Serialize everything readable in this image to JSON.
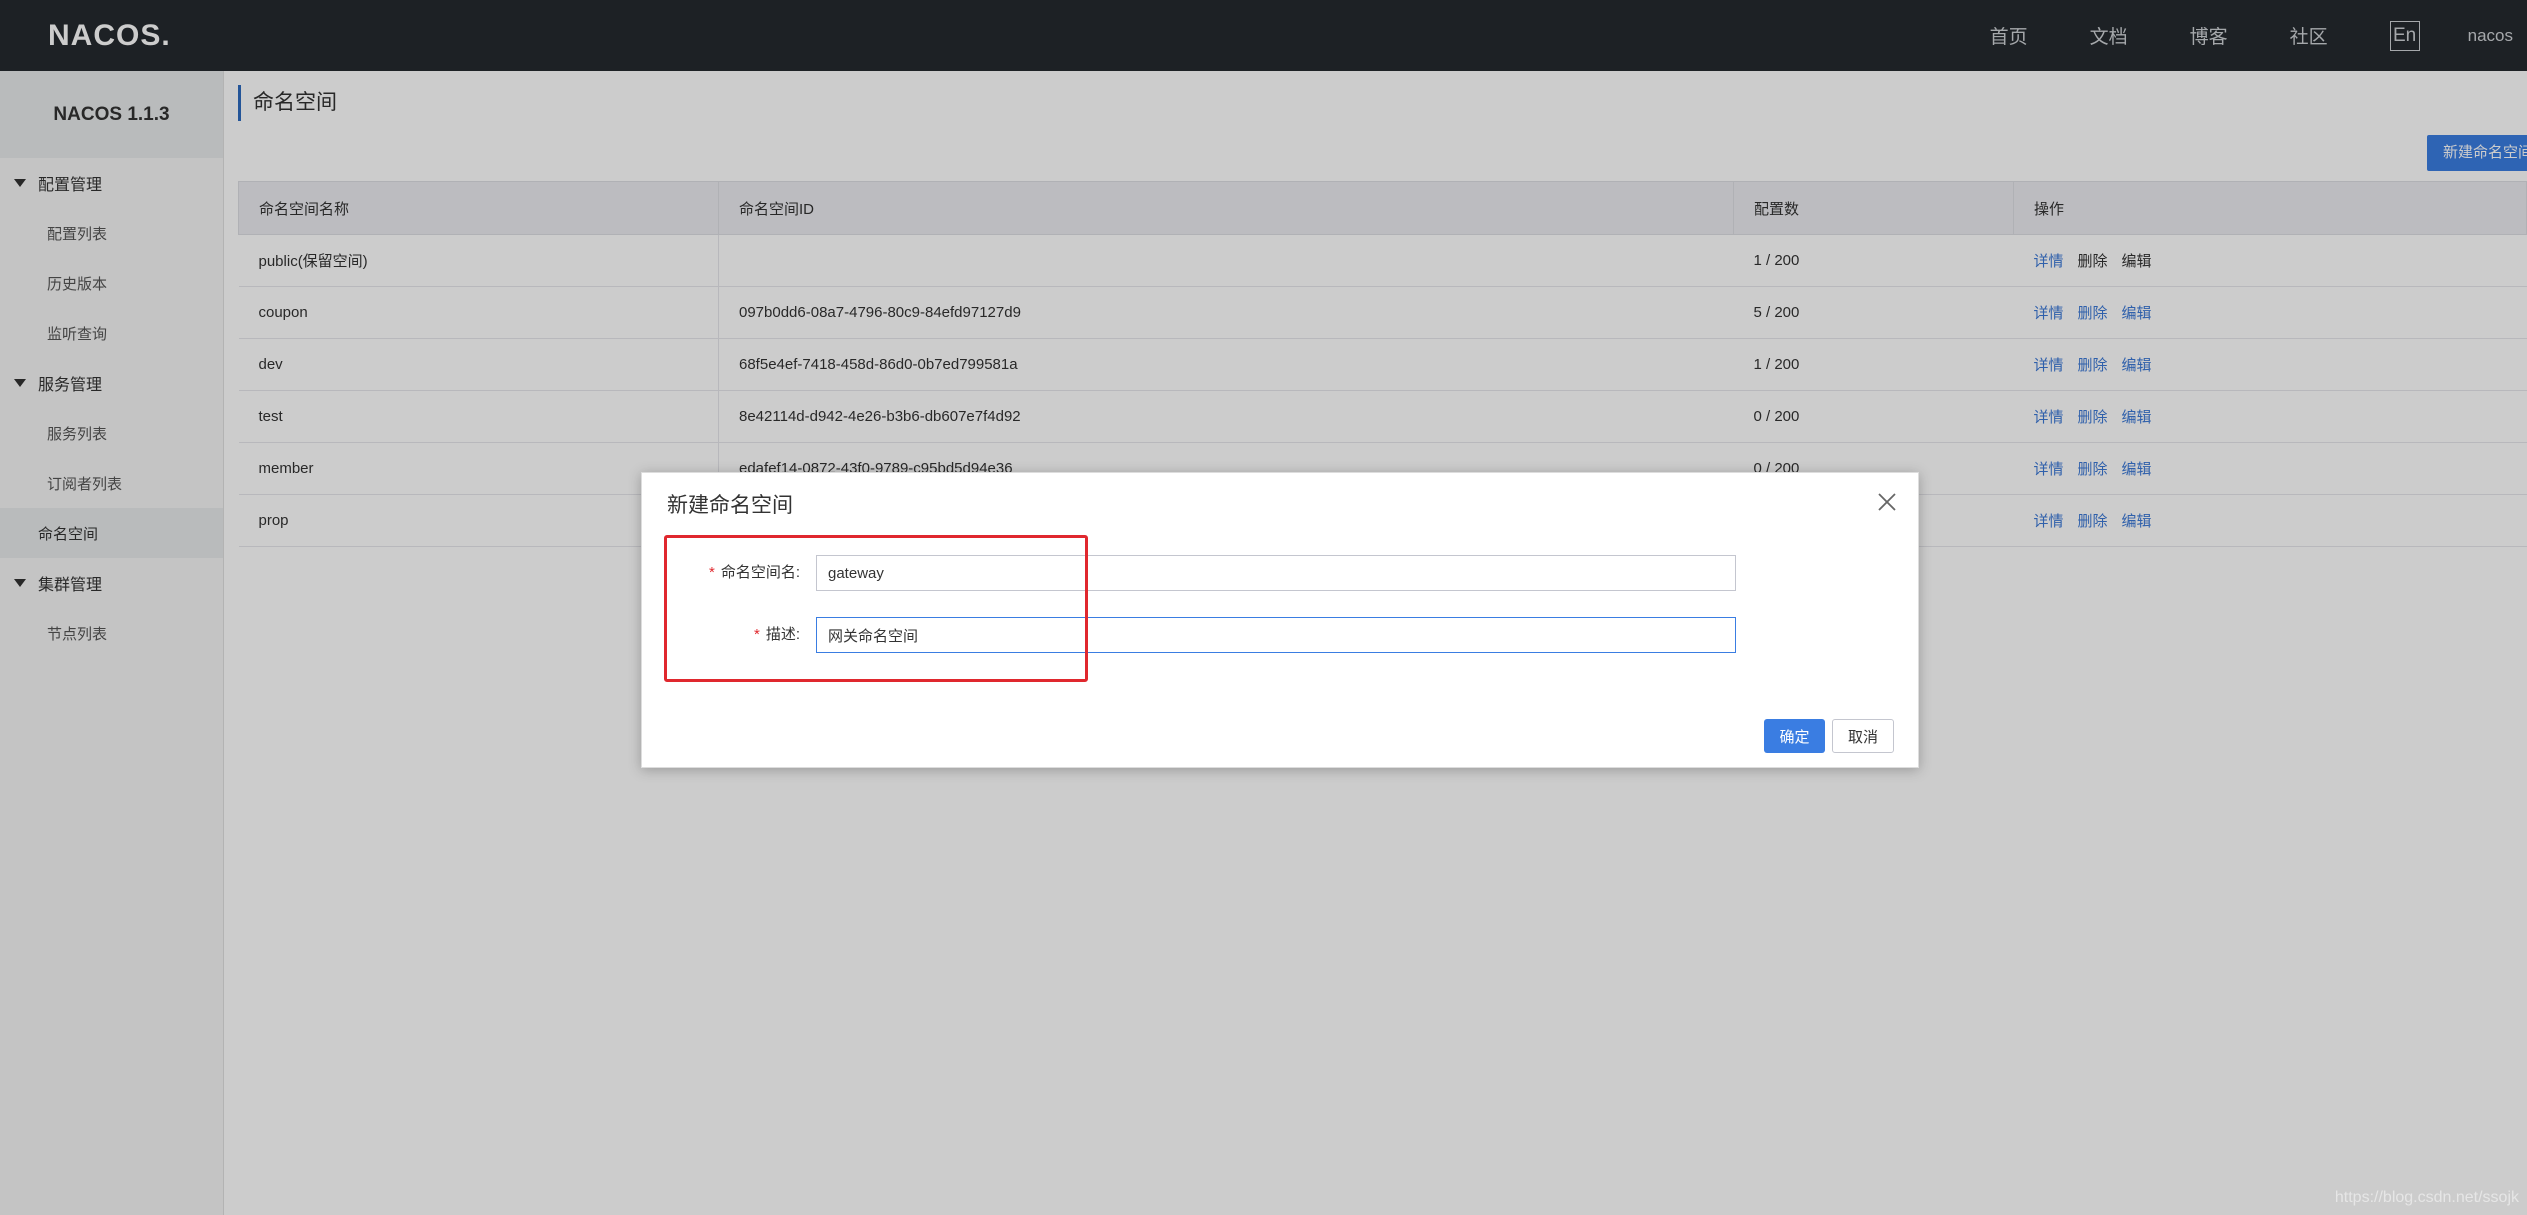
{
  "topbar": {
    "logo": "NACOS.",
    "nav": [
      "首页",
      "文档",
      "博客",
      "社区"
    ],
    "lang": "En",
    "user": "nacos"
  },
  "sidebar": {
    "title": "NACOS 1.1.3",
    "groups": [
      {
        "label": "配置管理",
        "items": [
          "配置列表",
          "历史版本",
          "监听查询"
        ]
      },
      {
        "label": "服务管理",
        "items": [
          "服务列表",
          "订阅者列表"
        ]
      },
      {
        "label": "命名空间",
        "items": []
      },
      {
        "label": "集群管理",
        "items": [
          "节点列表"
        ]
      }
    ]
  },
  "page": {
    "title": "命名空间",
    "create_button": "新建命名空间"
  },
  "table": {
    "headers": [
      "命名空间名称",
      "命名空间ID",
      "配置数",
      "操作"
    ],
    "rows": [
      {
        "name": "public(保留空间)",
        "id": "",
        "count": "1 / 200"
      },
      {
        "name": "coupon",
        "id": "097b0dd6-08a7-4796-80c9-84efd97127d9",
        "count": "5 / 200"
      },
      {
        "name": "dev",
        "id": "68f5e4ef-7418-458d-86d0-0b7ed799581a",
        "count": "1 / 200"
      },
      {
        "name": "test",
        "id": "8e42114d-d942-4e26-b3b6-db607e7f4d92",
        "count": "0 / 200"
      },
      {
        "name": "member",
        "id": "edafef14-0872-43f0-9789-c95bd5d94e36",
        "count": "0 / 200"
      },
      {
        "name": "prop",
        "id": "",
        "count": ""
      }
    ],
    "ops": [
      "详情",
      "删除",
      "编辑"
    ]
  },
  "dialog": {
    "title": "新建命名空间",
    "name_label": "命名空间名:",
    "name_value": "gateway",
    "desc_label": "描述:",
    "desc_value": "网关命名空间",
    "required_mark": "*",
    "ok": "确定",
    "cancel": "取消"
  },
  "watermark": "https://blog.csdn.net/ssojk"
}
